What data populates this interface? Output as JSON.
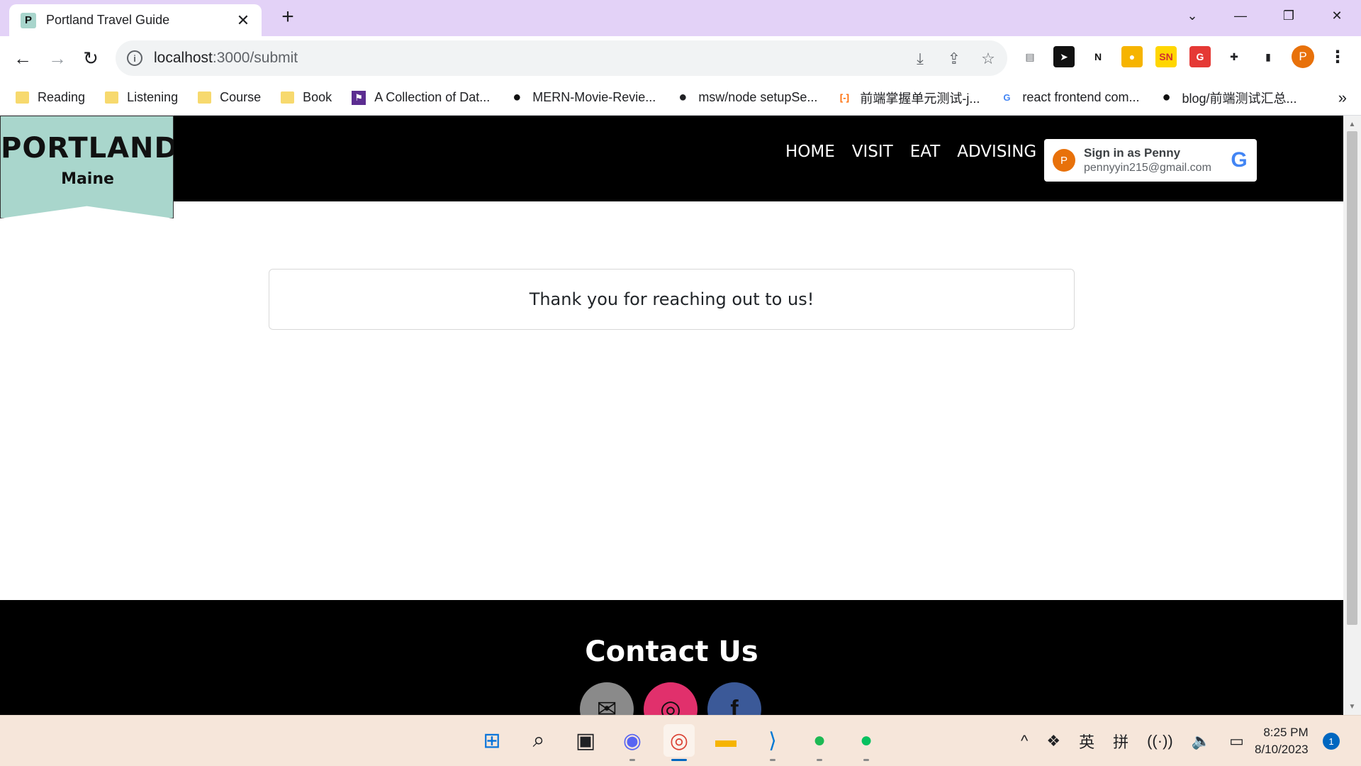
{
  "browser": {
    "tab": {
      "favicon_letter": "P",
      "title": "Portland Travel Guide",
      "close": "✕"
    },
    "new_tab": "+",
    "window_controls": {
      "tabsearch": "⌄",
      "minimize": "—",
      "restore": "❐",
      "close": "✕"
    },
    "nav": {
      "back": "←",
      "forward": "→",
      "reload": "↻"
    },
    "url": {
      "host": "localhost",
      "path": ":3000/submit"
    },
    "omnibox_actions": [
      "install-icon",
      "share-icon",
      "star-icon"
    ],
    "extensions": [
      {
        "name": "reader-icon",
        "label": "▤",
        "bg": "#ffffff",
        "fg": "#5f6368"
      },
      {
        "name": "send-icon",
        "label": "➤",
        "bg": "#111111",
        "fg": "#ffffff"
      },
      {
        "name": "notion-icon",
        "label": "N",
        "bg": "#ffffff",
        "fg": "#111111"
      },
      {
        "name": "ext-yellow-icon",
        "label": "●",
        "bg": "#f6b400",
        "fg": "#ffffff"
      },
      {
        "name": "sn-icon",
        "label": "SN",
        "bg": "#ffd600",
        "fg": "#d32f2f"
      },
      {
        "name": "grammarly-icon",
        "label": "G",
        "bg": "#e53935",
        "fg": "#ffffff"
      },
      {
        "name": "puzzle-icon",
        "label": "✚",
        "bg": "#ffffff",
        "fg": "#202124"
      },
      {
        "name": "sidepanel-icon",
        "label": "▮",
        "bg": "#ffffff",
        "fg": "#202124"
      }
    ],
    "profile_letter": "P",
    "menu": "⋮",
    "bookmarks": [
      {
        "label": "Reading",
        "type": "folder"
      },
      {
        "label": "Listening",
        "type": "folder"
      },
      {
        "label": "Course",
        "type": "folder"
      },
      {
        "label": "Book",
        "type": "folder"
      },
      {
        "label": "A Collection of Dat...",
        "type": "flag"
      },
      {
        "label": "MERN-Movie-Revie...",
        "type": "github"
      },
      {
        "label": "msw/node setupSe...",
        "type": "globe"
      },
      {
        "label": "前端掌握单元测试-j...",
        "type": "aliyun"
      },
      {
        "label": "react frontend com...",
        "type": "google"
      },
      {
        "label": "blog/前端测试汇总...",
        "type": "github"
      }
    ],
    "bookmarks_more": "»"
  },
  "site": {
    "logo": {
      "title": "PORTLAND",
      "subtitle": "Maine"
    },
    "nav": [
      "HOME",
      "VISIT",
      "EAT",
      "ADVISING"
    ],
    "google_signin": {
      "avatar_letter": "P",
      "name": "Sign in as Penny",
      "email": "pennyyin215@gmail.com",
      "g": "G"
    },
    "message": "Thank you for reaching out to us!",
    "footer": {
      "title": "Contact Us",
      "socials": [
        {
          "name": "mail-icon",
          "glyph": "✉",
          "color": "#8a8a8a"
        },
        {
          "name": "instagram-icon",
          "glyph": "◎",
          "color": "#e1306c"
        },
        {
          "name": "facebook-icon",
          "glyph": "f",
          "color": "#3b5998"
        }
      ]
    }
  },
  "taskbar": {
    "apps": [
      {
        "name": "start-icon",
        "glyph": "⊞",
        "color": "#0a74da"
      },
      {
        "name": "search-icon",
        "glyph": "⌕",
        "color": "#202124"
      },
      {
        "name": "task-view-icon",
        "glyph": "▣",
        "color": "#202124"
      },
      {
        "name": "discord-icon",
        "glyph": "◉",
        "color": "#5865f2",
        "running": true
      },
      {
        "name": "chrome-icon",
        "glyph": "◎",
        "color": "#db4437",
        "running": true,
        "active": true
      },
      {
        "name": "file-explorer-icon",
        "glyph": "▬",
        "color": "#f6b400"
      },
      {
        "name": "vscode-icon",
        "glyph": "⟩",
        "color": "#0078d4",
        "running": true
      },
      {
        "name": "spotify-icon",
        "glyph": "●",
        "color": "#1db954",
        "running": true
      },
      {
        "name": "wechat-icon",
        "glyph": "●",
        "color": "#07c160",
        "running": true
      }
    ],
    "tray": [
      "^",
      "❖",
      "英",
      "拼",
      "((·))",
      "🔈",
      "▭"
    ],
    "time": "8:25 PM",
    "date": "8/10/2023",
    "notifications": "1"
  }
}
